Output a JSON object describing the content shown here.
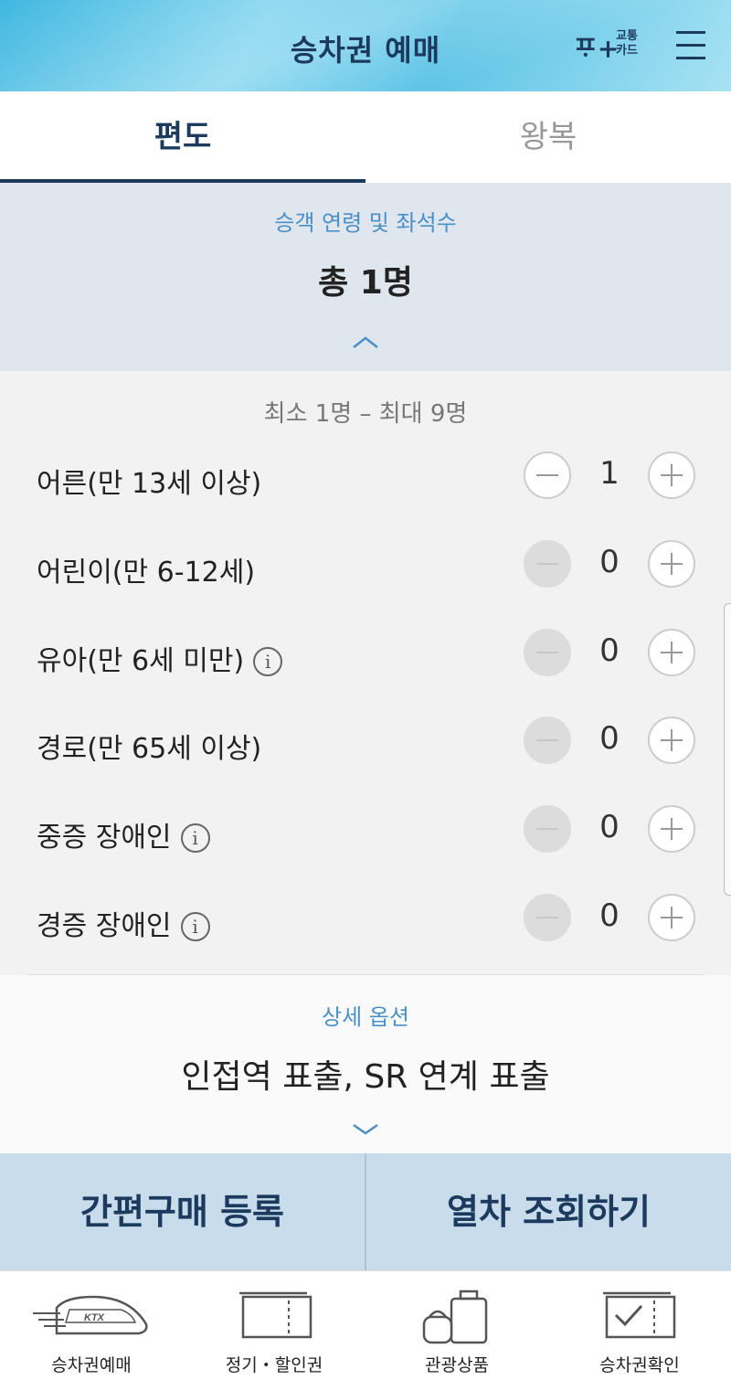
{
  "header": {
    "title": "승차권 예매",
    "card_logo_mark": "ᄑᆞ+",
    "card_logo_line1": "교통",
    "card_logo_line2": "카드"
  },
  "tabs": [
    {
      "label": "편도",
      "active": true
    },
    {
      "label": "왕복",
      "active": false
    }
  ],
  "passenger_section": {
    "label": "승객 연령 및 좌석수",
    "summary": "총 1명",
    "range_note": "최소 1명 – 최대 9명"
  },
  "passengers": [
    {
      "label": "어른(만 13세 이상)",
      "count": "1",
      "info": false,
      "minus_enabled": true
    },
    {
      "label": "어린이(만 6-12세)",
      "count": "0",
      "info": false,
      "minus_enabled": false
    },
    {
      "label": "유아(만 6세 미만)",
      "count": "0",
      "info": true,
      "minus_enabled": false
    },
    {
      "label": "경로(만 65세 이상)",
      "count": "0",
      "info": false,
      "minus_enabled": false
    },
    {
      "label": "중증 장애인",
      "count": "0",
      "info": true,
      "minus_enabled": false
    },
    {
      "label": "경증 장애인",
      "count": "0",
      "info": true,
      "minus_enabled": false
    }
  ],
  "options_section": {
    "label": "상세 옵션",
    "value": "인접역 표출, SR 연계 표출"
  },
  "actions": {
    "left": "간편구매 등록",
    "right": "열차 조회하기"
  },
  "bottom_nav": [
    {
      "label": "승차권예매",
      "icon": "ktx-train-icon",
      "badge": "KTX"
    },
    {
      "label": "정기・할인권",
      "icon": "ticket-icon"
    },
    {
      "label": "관광상품",
      "icon": "luggage-icon"
    },
    {
      "label": "승차권확인",
      "icon": "ticket-check-icon"
    }
  ],
  "colors": {
    "brand_dark": "#1c3a5e",
    "accent_blue": "#4a90c8",
    "action_bg": "#c8dcec"
  }
}
